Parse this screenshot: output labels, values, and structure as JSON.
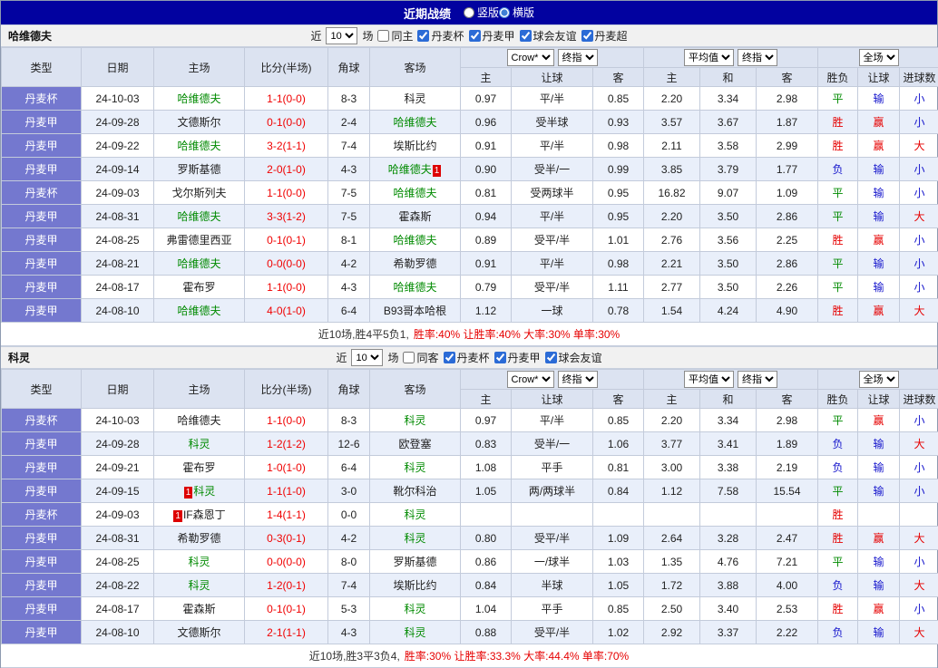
{
  "title_bar": {
    "title": "近期战绩",
    "radios": [
      {
        "label": "竖版",
        "checked": false
      },
      {
        "label": "横版",
        "checked": true
      }
    ]
  },
  "filter_labels": {
    "near": "近",
    "games": "场"
  },
  "table_header": {
    "type": "类型",
    "date": "日期",
    "home": "主场",
    "score": "比分(半场)",
    "corner": "角球",
    "away": "客场",
    "odds_selects": [
      "Crow*",
      "终指"
    ],
    "avg_selects": [
      "平均值",
      "终指"
    ],
    "full_select": "全场",
    "sub": [
      "主",
      "让球",
      "客",
      "主",
      "和",
      "客",
      "胜负",
      "让球",
      "进球数"
    ]
  },
  "sections": [
    {
      "team": "哈维德夫",
      "filter": {
        "count": "10",
        "same": {
          "label": "同主",
          "checked": false
        },
        "leagues": [
          {
            "label": "丹麦杯",
            "checked": true
          },
          {
            "label": "丹麦甲",
            "checked": true
          },
          {
            "label": "球会友谊",
            "checked": true
          },
          {
            "label": "丹麦超",
            "checked": true
          }
        ]
      },
      "rows": [
        {
          "league": "丹麦杯",
          "date": "24-10-03",
          "home": "哈维德夫",
          "hc": "g",
          "hb": "",
          "hbp": "",
          "score": "1-1(0-0)",
          "corner": "8-3",
          "away": "科灵",
          "ac": "",
          "ab": "",
          "abp": "",
          "o": [
            "0.97",
            "平/半",
            "0.85"
          ],
          "m": [
            "2.20",
            "3.34",
            "2.98"
          ],
          "r": [
            "平",
            "g"
          ],
          "l": [
            "输",
            "b"
          ],
          "gs": [
            "小",
            "b"
          ]
        },
        {
          "league": "丹麦甲",
          "date": "24-09-28",
          "home": "文德斯尔",
          "hc": "",
          "hb": "",
          "hbp": "",
          "score": "0-1(0-0)",
          "corner": "2-4",
          "away": "哈维德夫",
          "ac": "g",
          "ab": "",
          "abp": "",
          "o": [
            "0.96",
            "受半球",
            "0.93"
          ],
          "m": [
            "3.57",
            "3.67",
            "1.87"
          ],
          "r": [
            "胜",
            "r"
          ],
          "l": [
            "赢",
            "r"
          ],
          "gs": [
            "小",
            "b"
          ]
        },
        {
          "league": "丹麦甲",
          "date": "24-09-22",
          "home": "哈维德夫",
          "hc": "g",
          "hb": "",
          "hbp": "",
          "score": "3-2(1-1)",
          "corner": "7-4",
          "away": "埃斯比约",
          "ac": "",
          "ab": "",
          "abp": "",
          "o": [
            "0.91",
            "平/半",
            "0.98"
          ],
          "m": [
            "2.11",
            "3.58",
            "2.99"
          ],
          "r": [
            "胜",
            "r"
          ],
          "l": [
            "赢",
            "r"
          ],
          "gs": [
            "大",
            "r"
          ]
        },
        {
          "league": "丹麦甲",
          "date": "24-09-14",
          "home": "罗斯基德",
          "hc": "",
          "hb": "",
          "hbp": "",
          "score": "2-0(1-0)",
          "corner": "4-3",
          "away": "哈维德夫",
          "ac": "g",
          "ab": "1",
          "abp": "post",
          "o": [
            "0.90",
            "受半/一",
            "0.99"
          ],
          "m": [
            "3.85",
            "3.79",
            "1.77"
          ],
          "r": [
            "负",
            "b"
          ],
          "l": [
            "输",
            "b"
          ],
          "gs": [
            "小",
            "b"
          ]
        },
        {
          "league": "丹麦杯",
          "date": "24-09-03",
          "home": "戈尔斯列夫",
          "hc": "",
          "hb": "",
          "hbp": "",
          "score": "1-1(0-0)",
          "corner": "7-5",
          "away": "哈维德夫",
          "ac": "g",
          "ab": "",
          "abp": "",
          "o": [
            "0.81",
            "受两球半",
            "0.95"
          ],
          "m": [
            "16.82",
            "9.07",
            "1.09"
          ],
          "r": [
            "平",
            "g"
          ],
          "l": [
            "输",
            "b"
          ],
          "gs": [
            "小",
            "b"
          ]
        },
        {
          "league": "丹麦甲",
          "date": "24-08-31",
          "home": "哈维德夫",
          "hc": "g",
          "hb": "",
          "hbp": "",
          "score": "3-3(1-2)",
          "corner": "7-5",
          "away": "霍森斯",
          "ac": "",
          "ab": "",
          "abp": "",
          "o": [
            "0.94",
            "平/半",
            "0.95"
          ],
          "m": [
            "2.20",
            "3.50",
            "2.86"
          ],
          "r": [
            "平",
            "g"
          ],
          "l": [
            "输",
            "b"
          ],
          "gs": [
            "大",
            "r"
          ]
        },
        {
          "league": "丹麦甲",
          "date": "24-08-25",
          "home": "弗雷德里西亚",
          "hc": "",
          "hb": "",
          "hbp": "",
          "score": "0-1(0-1)",
          "corner": "8-1",
          "away": "哈维德夫",
          "ac": "g",
          "ab": "",
          "abp": "",
          "o": [
            "0.89",
            "受平/半",
            "1.01"
          ],
          "m": [
            "2.76",
            "3.56",
            "2.25"
          ],
          "r": [
            "胜",
            "r"
          ],
          "l": [
            "赢",
            "r"
          ],
          "gs": [
            "小",
            "b"
          ]
        },
        {
          "league": "丹麦甲",
          "date": "24-08-21",
          "home": "哈维德夫",
          "hc": "g",
          "hb": "",
          "hbp": "",
          "score": "0-0(0-0)",
          "corner": "4-2",
          "away": "希勒罗德",
          "ac": "",
          "ab": "",
          "abp": "",
          "o": [
            "0.91",
            "平/半",
            "0.98"
          ],
          "m": [
            "2.21",
            "3.50",
            "2.86"
          ],
          "r": [
            "平",
            "g"
          ],
          "l": [
            "输",
            "b"
          ],
          "gs": [
            "小",
            "b"
          ]
        },
        {
          "league": "丹麦甲",
          "date": "24-08-17",
          "home": "霍布罗",
          "hc": "",
          "hb": "",
          "hbp": "",
          "score": "1-1(0-0)",
          "corner": "4-3",
          "away": "哈维德夫",
          "ac": "g",
          "ab": "",
          "abp": "",
          "o": [
            "0.79",
            "受平/半",
            "1.11"
          ],
          "m": [
            "2.77",
            "3.50",
            "2.26"
          ],
          "r": [
            "平",
            "g"
          ],
          "l": [
            "输",
            "b"
          ],
          "gs": [
            "小",
            "b"
          ]
        },
        {
          "league": "丹麦甲",
          "date": "24-08-10",
          "home": "哈维德夫",
          "hc": "g",
          "hb": "",
          "hbp": "",
          "score": "4-0(1-0)",
          "corner": "6-4",
          "away": "B93哥本哈根",
          "ac": "",
          "ab": "",
          "abp": "",
          "o": [
            "1.12",
            "一球",
            "0.78"
          ],
          "m": [
            "1.54",
            "4.24",
            "4.90"
          ],
          "r": [
            "胜",
            "r"
          ],
          "l": [
            "赢",
            "r"
          ],
          "gs": [
            "大",
            "r"
          ]
        }
      ],
      "summary": {
        "prefix": "近10场,胜4平5负1,",
        "rates": "胜率:40% 让胜率:40% 大率:30% 单率:30%"
      }
    },
    {
      "team": "科灵",
      "filter": {
        "count": "10",
        "same": {
          "label": "同客",
          "checked": false
        },
        "leagues": [
          {
            "label": "丹麦杯",
            "checked": true
          },
          {
            "label": "丹麦甲",
            "checked": true
          },
          {
            "label": "球会友谊",
            "checked": true
          }
        ]
      },
      "rows": [
        {
          "league": "丹麦杯",
          "date": "24-10-03",
          "home": "哈维德夫",
          "hc": "",
          "hb": "",
          "hbp": "",
          "score": "1-1(0-0)",
          "corner": "8-3",
          "away": "科灵",
          "ac": "g",
          "ab": "",
          "abp": "",
          "o": [
            "0.97",
            "平/半",
            "0.85"
          ],
          "m": [
            "2.20",
            "3.34",
            "2.98"
          ],
          "r": [
            "平",
            "g"
          ],
          "l": [
            "赢",
            "r"
          ],
          "gs": [
            "小",
            "b"
          ]
        },
        {
          "league": "丹麦甲",
          "date": "24-09-28",
          "home": "科灵",
          "hc": "g",
          "hb": "",
          "hbp": "",
          "score": "1-2(1-2)",
          "corner": "12-6",
          "away": "欧登塞",
          "ac": "",
          "ab": "",
          "abp": "",
          "o": [
            "0.83",
            "受半/一",
            "1.06"
          ],
          "m": [
            "3.77",
            "3.41",
            "1.89"
          ],
          "r": [
            "负",
            "b"
          ],
          "l": [
            "输",
            "b"
          ],
          "gs": [
            "大",
            "r"
          ]
        },
        {
          "league": "丹麦甲",
          "date": "24-09-21",
          "home": "霍布罗",
          "hc": "",
          "hb": "",
          "hbp": "",
          "score": "1-0(1-0)",
          "corner": "6-4",
          "away": "科灵",
          "ac": "g",
          "ab": "",
          "abp": "",
          "o": [
            "1.08",
            "平手",
            "0.81"
          ],
          "m": [
            "3.00",
            "3.38",
            "2.19"
          ],
          "r": [
            "负",
            "b"
          ],
          "l": [
            "输",
            "b"
          ],
          "gs": [
            "小",
            "b"
          ]
        },
        {
          "league": "丹麦甲",
          "date": "24-09-15",
          "home": "科灵",
          "hc": "g",
          "hb": "1",
          "hbp": "pre",
          "score": "1-1(1-0)",
          "corner": "3-0",
          "away": "靴尔科治",
          "ac": "",
          "ab": "",
          "abp": "",
          "o": [
            "1.05",
            "两/两球半",
            "0.84"
          ],
          "m": [
            "1.12",
            "7.58",
            "15.54"
          ],
          "r": [
            "平",
            "g"
          ],
          "l": [
            "输",
            "b"
          ],
          "gs": [
            "小",
            "b"
          ]
        },
        {
          "league": "丹麦杯",
          "date": "24-09-03",
          "home": "IF森恩丁",
          "hc": "",
          "hb": "1",
          "hbp": "pre",
          "score": "1-4(1-1)",
          "corner": "0-0",
          "away": "科灵",
          "ac": "g",
          "ab": "",
          "abp": "",
          "o": [
            "",
            "",
            ""
          ],
          "m": [
            "",
            "",
            ""
          ],
          "r": [
            "胜",
            "r"
          ],
          "l": [
            "",
            ""
          ],
          "gs": [
            "",
            ""
          ]
        },
        {
          "league": "丹麦甲",
          "date": "24-08-31",
          "home": "希勒罗德",
          "hc": "",
          "hb": "",
          "hbp": "",
          "score": "0-3(0-1)",
          "corner": "4-2",
          "away": "科灵",
          "ac": "g",
          "ab": "",
          "abp": "",
          "o": [
            "0.80",
            "受平/半",
            "1.09"
          ],
          "m": [
            "2.64",
            "3.28",
            "2.47"
          ],
          "r": [
            "胜",
            "r"
          ],
          "l": [
            "赢",
            "r"
          ],
          "gs": [
            "大",
            "r"
          ]
        },
        {
          "league": "丹麦甲",
          "date": "24-08-25",
          "home": "科灵",
          "hc": "g",
          "hb": "",
          "hbp": "",
          "score": "0-0(0-0)",
          "corner": "8-0",
          "away": "罗斯基德",
          "ac": "",
          "ab": "",
          "abp": "",
          "o": [
            "0.86",
            "一/球半",
            "1.03"
          ],
          "m": [
            "1.35",
            "4.76",
            "7.21"
          ],
          "r": [
            "平",
            "g"
          ],
          "l": [
            "输",
            "b"
          ],
          "gs": [
            "小",
            "b"
          ]
        },
        {
          "league": "丹麦甲",
          "date": "24-08-22",
          "home": "科灵",
          "hc": "g",
          "hb": "",
          "hbp": "",
          "score": "1-2(0-1)",
          "corner": "7-4",
          "away": "埃斯比约",
          "ac": "",
          "ab": "",
          "abp": "",
          "o": [
            "0.84",
            "半球",
            "1.05"
          ],
          "m": [
            "1.72",
            "3.88",
            "4.00"
          ],
          "r": [
            "负",
            "b"
          ],
          "l": [
            "输",
            "b"
          ],
          "gs": [
            "大",
            "r"
          ]
        },
        {
          "league": "丹麦甲",
          "date": "24-08-17",
          "home": "霍森斯",
          "hc": "",
          "hb": "",
          "hbp": "",
          "score": "0-1(0-1)",
          "corner": "5-3",
          "away": "科灵",
          "ac": "g",
          "ab": "",
          "abp": "",
          "o": [
            "1.04",
            "平手",
            "0.85"
          ],
          "m": [
            "2.50",
            "3.40",
            "2.53"
          ],
          "r": [
            "胜",
            "r"
          ],
          "l": [
            "赢",
            "r"
          ],
          "gs": [
            "小",
            "b"
          ]
        },
        {
          "league": "丹麦甲",
          "date": "24-08-10",
          "home": "文德斯尔",
          "hc": "",
          "hb": "",
          "hbp": "",
          "score": "2-1(1-1)",
          "corner": "4-3",
          "away": "科灵",
          "ac": "g",
          "ab": "",
          "abp": "",
          "o": [
            "0.88",
            "受平/半",
            "1.02"
          ],
          "m": [
            "2.92",
            "3.37",
            "2.22"
          ],
          "r": [
            "负",
            "b"
          ],
          "l": [
            "输",
            "b"
          ],
          "gs": [
            "大",
            "r"
          ]
        }
      ],
      "summary": {
        "prefix": "近10场,胜3平3负4,",
        "rates": "胜率:30% 让胜率:33.3% 大率:44.4% 单率:70%"
      }
    }
  ]
}
